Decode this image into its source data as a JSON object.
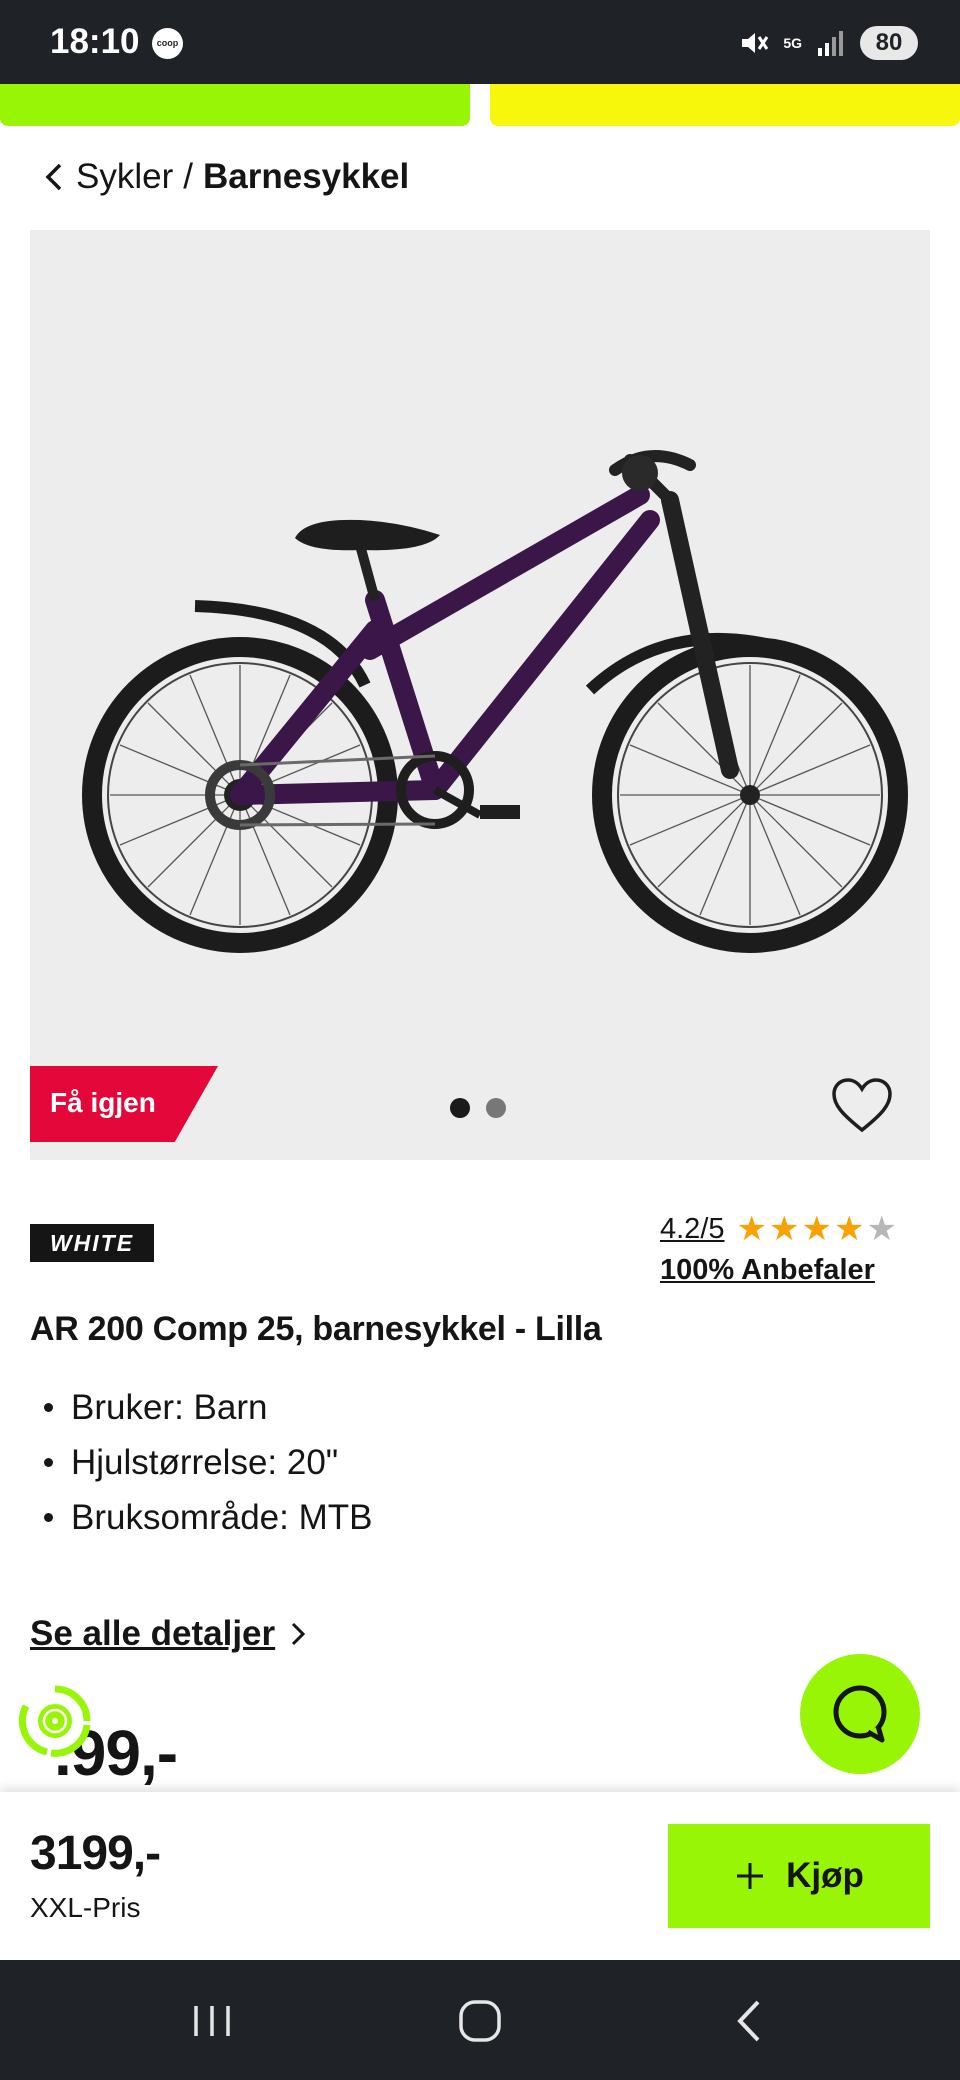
{
  "status_bar": {
    "time": "18:10",
    "carrier_badge": "coop",
    "network": "5G",
    "battery": "80"
  },
  "breadcrumb": {
    "parent": "Sykler",
    "separator": "/",
    "current": "Barnesykkel"
  },
  "gallery": {
    "badge": "Få igjen",
    "image_count": 2,
    "active_index": 0,
    "image_description": "purple children's mountain bike"
  },
  "product": {
    "brand": "WHITE",
    "rating": "4.2/5",
    "rating_value": 4.2,
    "rating_max": 5,
    "recommend": "100% Anbefaler",
    "title": "AR 200 Comp 25, barnesykkel - Lilla",
    "features": [
      "Bruker: Barn",
      "Hjulstørrelse: 20\"",
      "Bruksområde: MTB"
    ],
    "details_link": "Se alle detaljer",
    "partial_price": ".99,-"
  },
  "buy_bar": {
    "price": "3199,-",
    "price_label": "XXL-Pris",
    "buy_label": "Kjøp"
  },
  "colors": {
    "accent_green": "#98f506",
    "accent_yellow": "#f7f70b",
    "badge_red": "#e3073a",
    "star": "#f7a200",
    "bike_frame": "#3a1748"
  },
  "icons": {
    "back": "chevron-left-icon",
    "favorite": "heart-outline-icon",
    "chat": "chat-bubble-icon",
    "buy": "plus-icon",
    "eco": "recycle-icon"
  }
}
